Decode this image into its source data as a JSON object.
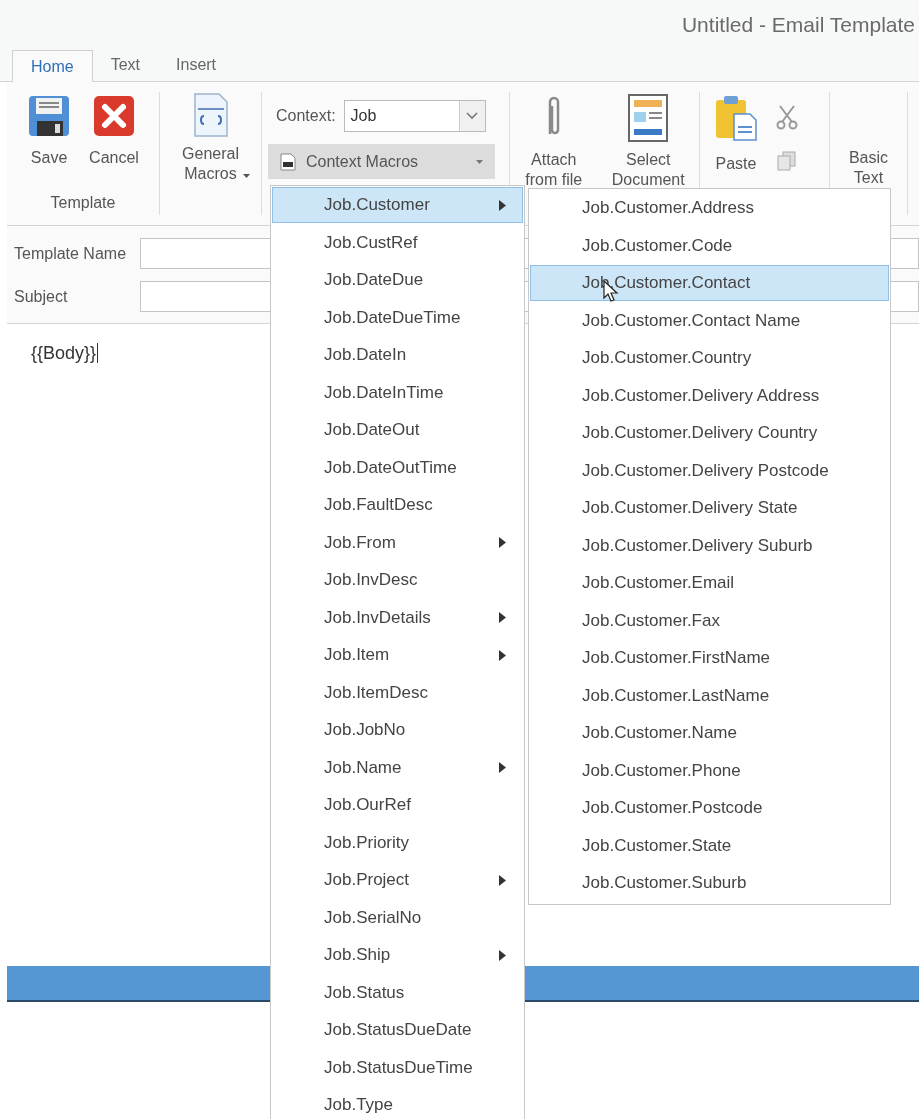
{
  "window": {
    "title": "Untitled - Email Template"
  },
  "tabs": [
    {
      "label": "Home",
      "selected": true
    },
    {
      "label": "Text",
      "selected": false
    },
    {
      "label": "Insert",
      "selected": false
    }
  ],
  "ribbon": {
    "save": "Save",
    "cancel": "Cancel",
    "group_label": "Template",
    "general_macros": "General Macros",
    "context_label": "Context:",
    "context_value": "Job",
    "context_macros": "Context Macros",
    "attach": "Attach from file",
    "select_document": "Select Document",
    "paste": "Paste",
    "basic_text": "Basic Text"
  },
  "fields": [
    {
      "label": "Template Name"
    },
    {
      "label": "Subject"
    }
  ],
  "body": "{{Body}}",
  "menu": [
    {
      "label": "Job.Customer",
      "submenu": true,
      "selected": true
    },
    {
      "label": "Job.CustRef",
      "submenu": false,
      "selected": false
    },
    {
      "label": "Job.DateDue",
      "submenu": false,
      "selected": false
    },
    {
      "label": "Job.DateDueTime",
      "submenu": false,
      "selected": false
    },
    {
      "label": "Job.DateIn",
      "submenu": false,
      "selected": false
    },
    {
      "label": "Job.DateInTime",
      "submenu": false,
      "selected": false
    },
    {
      "label": "Job.DateOut",
      "submenu": false,
      "selected": false
    },
    {
      "label": "Job.DateOutTime",
      "submenu": false,
      "selected": false
    },
    {
      "label": "Job.FaultDesc",
      "submenu": false,
      "selected": false
    },
    {
      "label": "Job.From",
      "submenu": true,
      "selected": false
    },
    {
      "label": "Job.InvDesc",
      "submenu": false,
      "selected": false
    },
    {
      "label": "Job.InvDetails",
      "submenu": true,
      "selected": false
    },
    {
      "label": "Job.Item",
      "submenu": true,
      "selected": false
    },
    {
      "label": "Job.ItemDesc",
      "submenu": false,
      "selected": false
    },
    {
      "label": "Job.JobNo",
      "submenu": false,
      "selected": false
    },
    {
      "label": "Job.Name",
      "submenu": true,
      "selected": false
    },
    {
      "label": "Job.OurRef",
      "submenu": false,
      "selected": false
    },
    {
      "label": "Job.Priority",
      "submenu": false,
      "selected": false
    },
    {
      "label": "Job.Project",
      "submenu": true,
      "selected": false
    },
    {
      "label": "Job.SerialNo",
      "submenu": false,
      "selected": false
    },
    {
      "label": "Job.Ship",
      "submenu": true,
      "selected": false
    },
    {
      "label": "Job.Status",
      "submenu": false,
      "selected": false
    },
    {
      "label": "Job.StatusDueDate",
      "submenu": false,
      "selected": false
    },
    {
      "label": "Job.StatusDueTime",
      "submenu": false,
      "selected": false
    },
    {
      "label": "Job.Type",
      "submenu": false,
      "selected": false
    }
  ],
  "submenu": [
    {
      "label": "Job.Customer.Address",
      "selected": false
    },
    {
      "label": "Job.Customer.Code",
      "selected": false
    },
    {
      "label": "Job.Customer.Contact",
      "selected": true
    },
    {
      "label": "Job.Customer.Contact Name",
      "selected": false
    },
    {
      "label": "Job.Customer.Country",
      "selected": false
    },
    {
      "label": "Job.Customer.Delivery Address",
      "selected": false
    },
    {
      "label": "Job.Customer.Delivery Country",
      "selected": false
    },
    {
      "label": "Job.Customer.Delivery Postcode",
      "selected": false
    },
    {
      "label": "Job.Customer.Delivery State",
      "selected": false
    },
    {
      "label": "Job.Customer.Delivery Suburb",
      "selected": false
    },
    {
      "label": "Job.Customer.Email",
      "selected": false
    },
    {
      "label": "Job.Customer.Fax",
      "selected": false
    },
    {
      "label": "Job.Customer.FirstName",
      "selected": false
    },
    {
      "label": "Job.Customer.LastName",
      "selected": false
    },
    {
      "label": "Job.Customer.Name",
      "selected": false
    },
    {
      "label": "Job.Customer.Phone",
      "selected": false
    },
    {
      "label": "Job.Customer.Postcode",
      "selected": false
    },
    {
      "label": "Job.Customer.State",
      "selected": false
    },
    {
      "label": "Job.Customer.Suburb",
      "selected": false
    }
  ]
}
